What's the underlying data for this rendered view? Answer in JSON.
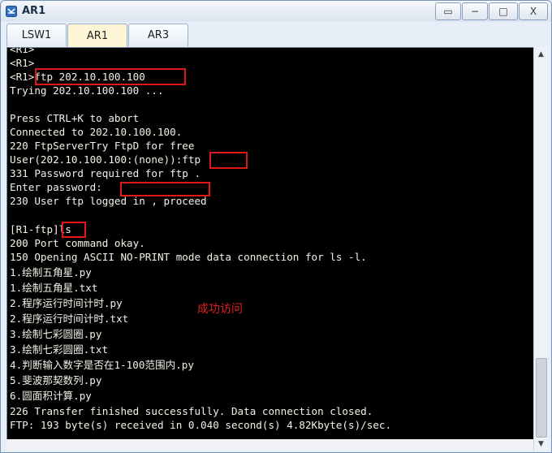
{
  "window": {
    "title": "AR1",
    "buttons": {
      "restore": "▭",
      "minimize": "−",
      "maximize": "□",
      "close": "X"
    }
  },
  "tabs": [
    {
      "label": "LSW1",
      "active": false
    },
    {
      "label": "AR1",
      "active": true
    },
    {
      "label": "AR3",
      "active": false
    }
  ],
  "terminal": {
    "lines": [
      "<R1>",
      "<R1>",
      "<R1>ftp 202.10.100.100",
      "Trying 202.10.100.100 ...",
      "",
      "Press CTRL+K to abort",
      "Connected to 202.10.100.100.",
      "220 FtpServerTry FtpD for free",
      "User(202.10.100.100:(none)):ftp",
      "331 Password required for ftp .",
      "Enter password:",
      "230 User ftp logged in , proceed",
      "",
      "[R1-ftp]ls",
      "200 Port command okay.",
      "150 Opening ASCII NO-PRINT mode data connection for ls -l.",
      "1.绘制五角星.py",
      "1.绘制五角星.txt",
      "2.程序运行时间计时.py",
      "2.程序运行时间计时.txt",
      "3.绘制七彩圆圈.py",
      "3.绘制七彩圆圈.txt",
      "4.判断输入数字是否在1-100范围内.py",
      "5.斐波那契数列.py",
      "6.圆面积计算.py",
      "226 Transfer finished successfully. Data connection closed.",
      "FTP: 193 byte(s) received in 0.040 second(s) 4.82Kbyte(s)/sec."
    ],
    "annotation": "成功访问"
  },
  "scrollbar": {
    "up_arrow": "▲",
    "down_arrow": "▼"
  },
  "colors": {
    "highlight": "#e01818",
    "terminal_bg": "#000000",
    "terminal_fg": "#f2f2e8"
  }
}
